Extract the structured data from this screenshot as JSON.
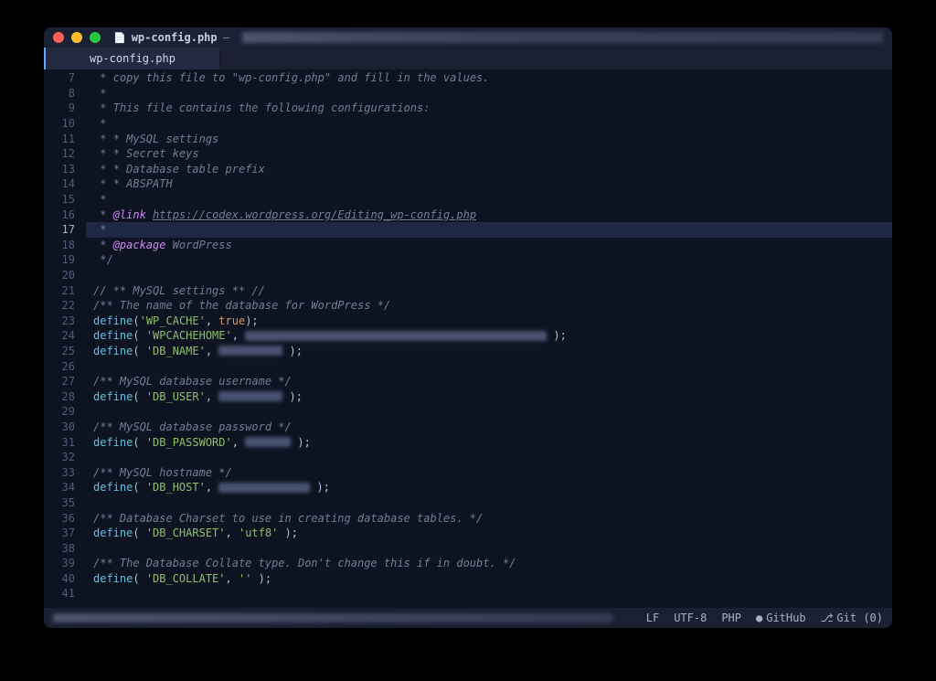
{
  "titlebar": {
    "filename": "wp-config.php",
    "separator": "—"
  },
  "tabs": [
    {
      "label": "wp-config.php",
      "active": true
    }
  ],
  "editor": {
    "current_line_index": 10,
    "lines": [
      {
        "n": 7,
        "tokens": [
          {
            "t": " * ",
            "c": "c-comment"
          },
          {
            "t": "copy this file to \"wp-config.php\" and fill in the values.",
            "c": "c-italic"
          }
        ]
      },
      {
        "n": 8,
        "tokens": [
          {
            "t": " *",
            "c": "c-comment"
          }
        ]
      },
      {
        "n": 9,
        "tokens": [
          {
            "t": " * ",
            "c": "c-comment"
          },
          {
            "t": "This file contains the following configurations:",
            "c": "c-italic"
          }
        ]
      },
      {
        "n": 10,
        "tokens": [
          {
            "t": " *",
            "c": "c-comment"
          }
        ]
      },
      {
        "n": 11,
        "tokens": [
          {
            "t": " * ",
            "c": "c-comment"
          },
          {
            "t": "* MySQL settings",
            "c": "c-italic"
          }
        ]
      },
      {
        "n": 12,
        "tokens": [
          {
            "t": " * ",
            "c": "c-comment"
          },
          {
            "t": "* Secret keys",
            "c": "c-italic"
          }
        ]
      },
      {
        "n": 13,
        "tokens": [
          {
            "t": " * ",
            "c": "c-comment"
          },
          {
            "t": "* Database table prefix",
            "c": "c-italic"
          }
        ]
      },
      {
        "n": 14,
        "tokens": [
          {
            "t": " * ",
            "c": "c-comment"
          },
          {
            "t": "* ABSPATH",
            "c": "c-italic"
          }
        ]
      },
      {
        "n": 15,
        "tokens": [
          {
            "t": " *",
            "c": "c-comment"
          }
        ]
      },
      {
        "n": 16,
        "tokens": [
          {
            "t": " * ",
            "c": "c-comment"
          },
          {
            "t": "@link",
            "c": "c-kw"
          },
          {
            "t": " ",
            "c": "c-comment"
          },
          {
            "t": "https://codex.wordpress.org/Editing_wp-config.php",
            "c": "c-link"
          }
        ]
      },
      {
        "n": 17,
        "tokens": [
          {
            "t": " *",
            "c": "c-comment"
          }
        ]
      },
      {
        "n": 18,
        "tokens": [
          {
            "t": " * ",
            "c": "c-comment"
          },
          {
            "t": "@package",
            "c": "c-kw"
          },
          {
            "t": " WordPress",
            "c": "c-italic"
          }
        ]
      },
      {
        "n": 19,
        "tokens": [
          {
            "t": " */",
            "c": "c-comment"
          }
        ]
      },
      {
        "n": 20,
        "tokens": []
      },
      {
        "n": 21,
        "tokens": [
          {
            "t": "// ** MySQL settings ** //",
            "c": "c-italic"
          }
        ]
      },
      {
        "n": 22,
        "tokens": [
          {
            "t": "/** The name of the database for WordPress */",
            "c": "c-italic"
          }
        ]
      },
      {
        "n": 23,
        "tokens": [
          {
            "t": "define",
            "c": "c-def"
          },
          {
            "t": "(",
            "c": "c-fg"
          },
          {
            "t": "'WP_CACHE'",
            "c": "c-str"
          },
          {
            "t": ", ",
            "c": "c-fg"
          },
          {
            "t": "true",
            "c": "c-num"
          },
          {
            "t": ");",
            "c": "c-fg"
          }
        ]
      },
      {
        "n": 24,
        "tokens": [
          {
            "t": "define",
            "c": "c-def"
          },
          {
            "t": "( ",
            "c": "c-fg"
          },
          {
            "t": "'WPCACHEHOME'",
            "c": "c-str"
          },
          {
            "t": ", ",
            "c": "c-fg"
          },
          {
            "blur": 330
          },
          {
            "t": " );",
            "c": "c-fg"
          }
        ]
      },
      {
        "n": 25,
        "tokens": [
          {
            "t": "define",
            "c": "c-def"
          },
          {
            "t": "( ",
            "c": "c-fg"
          },
          {
            "t": "'DB_NAME'",
            "c": "c-str"
          },
          {
            "t": ", ",
            "c": "c-fg"
          },
          {
            "blur": 70
          },
          {
            "t": " );",
            "c": "c-fg"
          }
        ]
      },
      {
        "n": 26,
        "tokens": []
      },
      {
        "n": 27,
        "tokens": [
          {
            "t": "/** MySQL database username */",
            "c": "c-italic"
          }
        ]
      },
      {
        "n": 28,
        "tokens": [
          {
            "t": "define",
            "c": "c-def"
          },
          {
            "t": "( ",
            "c": "c-fg"
          },
          {
            "t": "'DB_USER'",
            "c": "c-str"
          },
          {
            "t": ", ",
            "c": "c-fg"
          },
          {
            "blur": 70
          },
          {
            "t": " );",
            "c": "c-fg"
          }
        ]
      },
      {
        "n": 29,
        "tokens": []
      },
      {
        "n": 30,
        "tokens": [
          {
            "t": "/** MySQL database password */",
            "c": "c-italic"
          }
        ]
      },
      {
        "n": 31,
        "tokens": [
          {
            "t": "define",
            "c": "c-def"
          },
          {
            "t": "( ",
            "c": "c-fg"
          },
          {
            "t": "'DB_PASSWORD'",
            "c": "c-str"
          },
          {
            "t": ", ",
            "c": "c-fg"
          },
          {
            "blur": 50
          },
          {
            "t": " );",
            "c": "c-fg"
          }
        ]
      },
      {
        "n": 32,
        "tokens": []
      },
      {
        "n": 33,
        "tokens": [
          {
            "t": "/** MySQL hostname */",
            "c": "c-italic"
          }
        ]
      },
      {
        "n": 34,
        "tokens": [
          {
            "t": "define",
            "c": "c-def"
          },
          {
            "t": "( ",
            "c": "c-fg"
          },
          {
            "t": "'DB_HOST'",
            "c": "c-str"
          },
          {
            "t": ", ",
            "c": "c-fg"
          },
          {
            "blur": 100
          },
          {
            "t": " );",
            "c": "c-fg"
          }
        ]
      },
      {
        "n": 35,
        "tokens": []
      },
      {
        "n": 36,
        "tokens": [
          {
            "t": "/** Database Charset to use in creating database tables. */",
            "c": "c-italic"
          }
        ]
      },
      {
        "n": 37,
        "tokens": [
          {
            "t": "define",
            "c": "c-def"
          },
          {
            "t": "( ",
            "c": "c-fg"
          },
          {
            "t": "'DB_CHARSET'",
            "c": "c-str"
          },
          {
            "t": ", ",
            "c": "c-fg"
          },
          {
            "t": "'utf8'",
            "c": "c-str"
          },
          {
            "t": " );",
            "c": "c-fg"
          }
        ]
      },
      {
        "n": 38,
        "tokens": []
      },
      {
        "n": 39,
        "tokens": [
          {
            "t": "/** The Database Collate type. Don't change this if in doubt. */",
            "c": "c-italic"
          }
        ]
      },
      {
        "n": 40,
        "tokens": [
          {
            "t": "define",
            "c": "c-def"
          },
          {
            "t": "( ",
            "c": "c-fg"
          },
          {
            "t": "'DB_COLLATE'",
            "c": "c-str"
          },
          {
            "t": ", ",
            "c": "c-fg"
          },
          {
            "t": "''",
            "c": "c-str"
          },
          {
            "t": " );",
            "c": "c-fg"
          }
        ]
      },
      {
        "n": 41,
        "tokens": []
      }
    ]
  },
  "status": {
    "line_ending": "LF",
    "encoding": "UTF-8",
    "language": "PHP",
    "github": "GitHub",
    "git": "Git (0)"
  }
}
